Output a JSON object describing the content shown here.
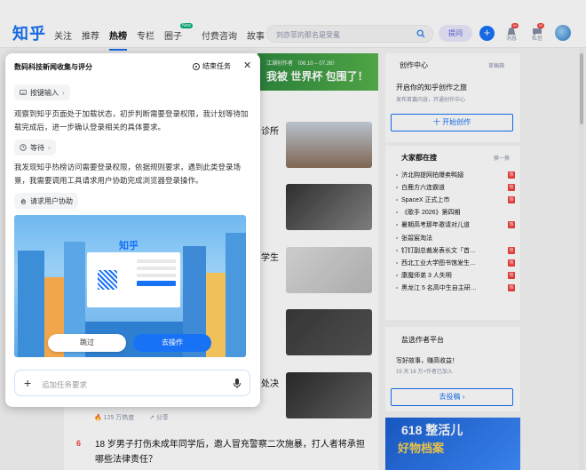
{
  "header": {
    "logo": "知乎",
    "nav": [
      "关注",
      "推荐",
      "热榜",
      "专栏",
      "圈子",
      "付费咨询",
      "故事"
    ],
    "active_nav": "热榜",
    "circle_badge": "New",
    "search_placeholder": "刘亦菲的那名是受冕",
    "ask_label": "提问",
    "messages_label": "消息",
    "private_msg_label": "私信",
    "messages_badge": "99",
    "private_msg_badge": "99"
  },
  "banner": {
    "small": "江湖创作者 （06.10 – 07.26）",
    "big": "我被 世界杯 包围了！"
  },
  "feed": {
    "row_index": "6",
    "row_title": "18 岁男子打伤未成年同学后，邀人冒充警察二次施暴，打人者将承担哪些法律责任？",
    "meta_heat": "125 万热度",
    "meta_share": "分享",
    "fragments": [
      "诊所",
      "学生",
      "处决"
    ]
  },
  "sidebar": {
    "creator_title": "创作中心",
    "creator_sub": "草稿箱",
    "creator_prompt": "开启你的知乎创作之旅",
    "creator_hint": "发布首篇内容，开通创作中心",
    "start_btn": "十 开始创作",
    "hot_title": "大家都在搜",
    "hot_refresh": "换一换",
    "hot_items": [
      {
        "text": "济北购提网拍爆卖鸭翅",
        "count": "",
        "tag": "热"
      },
      {
        "text": "白鹿方六连霸道",
        "count": "",
        "tag": "热"
      },
      {
        "text": "SpaceX 正式上市",
        "count": "",
        "tag": "热"
      },
      {
        "text": "《歌手 2026》第四期",
        "count": "",
        "tag": ""
      },
      {
        "text": "暑期高考那年邀请对儿道",
        "count": "",
        "tag": "热"
      },
      {
        "text": "张碧宸淘法",
        "count": "",
        "tag": ""
      },
      {
        "text": "钉钉副总裁发表长文「首…",
        "count": "",
        "tag": "热"
      },
      {
        "text": "西北工业大学图书馆发生…",
        "count": "",
        "tag": "热"
      },
      {
        "text": "康魔师弟 3 人失明",
        "count": "",
        "tag": "热"
      },
      {
        "text": "黑龙江 5 名高中生自主研…",
        "count": "",
        "tag": "热"
      }
    ],
    "earn_title": "盐选作者平台",
    "earn_text": "写好故事，赚高收益！",
    "earn_sub": "15 天 16 万+作者已加入",
    "earn_btn": "去投稿 ›",
    "ad_text": "618 整活儿",
    "ad_sub": "好物档案"
  },
  "panel": {
    "title": "数码科技新闻收集与评分",
    "end_task": "结束任务",
    "chip_input": "按键输入",
    "text1": "观察到知乎页面处于加载状态，初步判断需要登录权限，我计划等待加载完成后，进一步确认登录相关的具体要求。",
    "chip_wait": "等待",
    "text2": "我发现知乎热榜访问需要登录权限，依据规则要求，遇到此类登录场景，我需要调用工具请求用户协助完成浏览器登录操作。",
    "chip_request": "请求用户协助",
    "screenshot_logo": "知乎",
    "skip_label": "跳过",
    "go_label": "去操作",
    "input_placeholder": "追加任务要求"
  }
}
